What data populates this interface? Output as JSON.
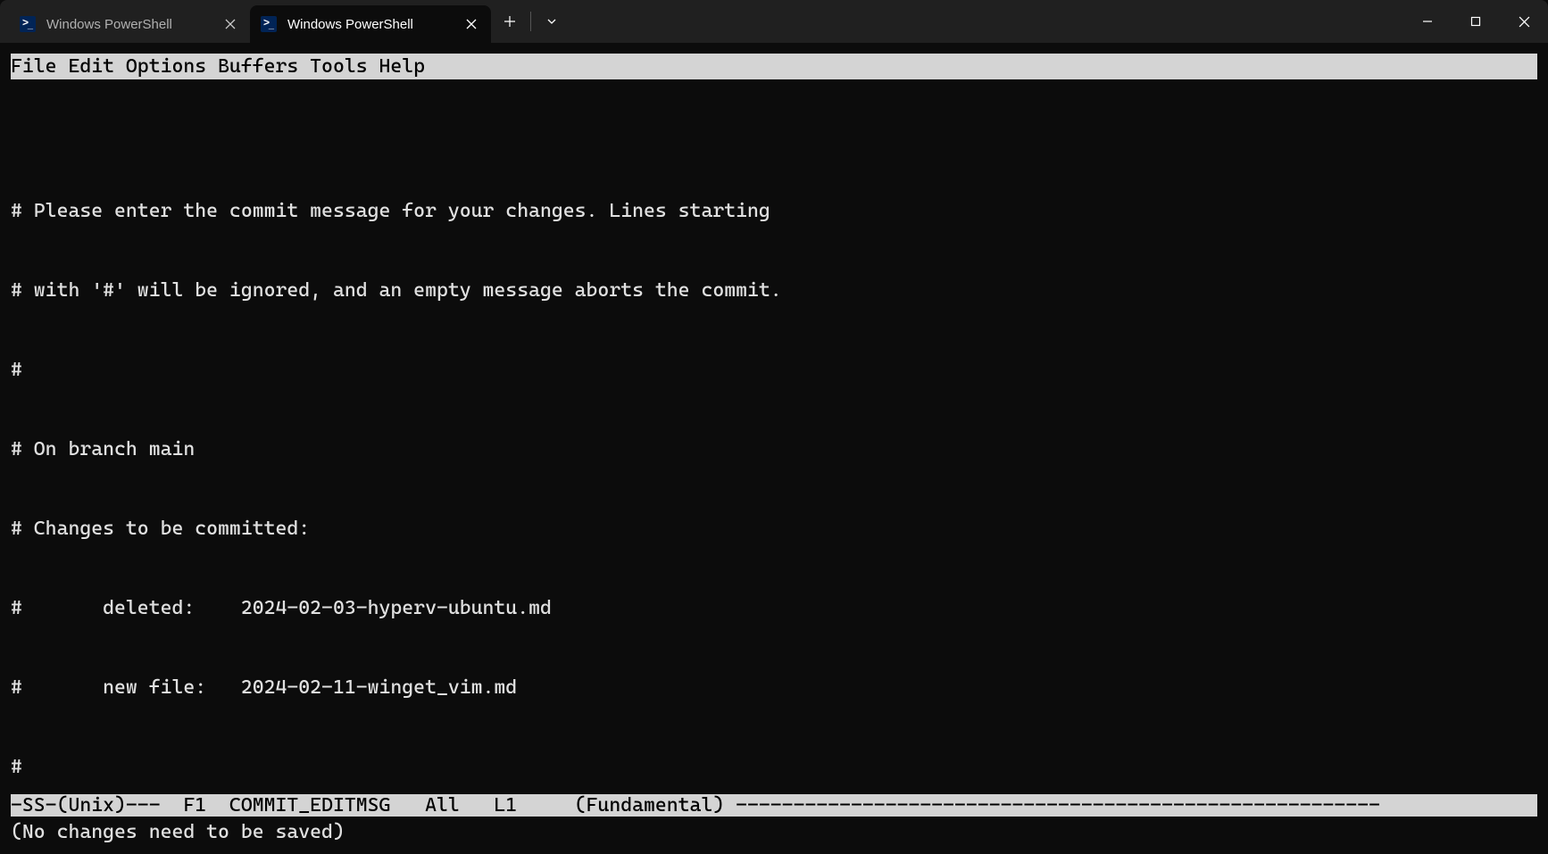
{
  "titlebar": {
    "tabs": [
      {
        "title": "Windows PowerShell",
        "active": false
      },
      {
        "title": "Windows PowerShell",
        "active": true
      }
    ]
  },
  "emacs": {
    "menu": [
      "File",
      "Edit",
      "Options",
      "Buffers",
      "Tools",
      "Help"
    ],
    "buffer_lines": [
      "",
      "# Please enter the commit message for your changes. Lines starting",
      "# with '#' will be ignored, and an empty message aborts the commit.",
      "#",
      "# On branch main",
      "# Changes to be committed:",
      "#       deleted:    2024-02-03-hyperv-ubuntu.md",
      "#       new file:   2024-02-11-winget_vim.md",
      "#"
    ],
    "modeline": {
      "prefix": "-SS-(Unix)---  F1  ",
      "buffer_name": "COMMIT_EDITMSG",
      "position": "   All   L1     ",
      "mode": "(Fundamental) ",
      "dashes": "--------------------------------------------------------"
    },
    "echo": "(No changes need to be saved)"
  }
}
